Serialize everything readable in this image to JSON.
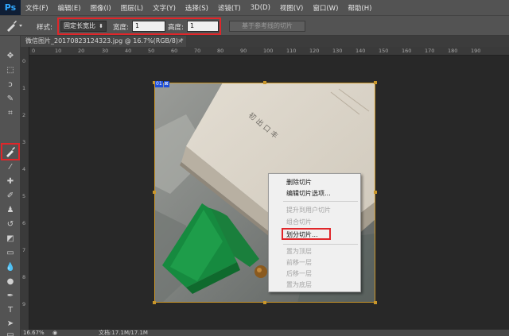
{
  "app": {
    "logo": "Ps"
  },
  "menu": [
    "文件(F)",
    "编辑(E)",
    "图像(I)",
    "图层(L)",
    "文字(Y)",
    "选择(S)",
    "滤镜(T)",
    "3D(D)",
    "视图(V)",
    "窗口(W)",
    "帮助(H)"
  ],
  "options": {
    "style_label": "样式:",
    "style_value": "固定长宽比",
    "width_label": "宽度:",
    "width_value": "1",
    "height_label": "高度:",
    "height_value": "1",
    "guides_button": "基于参考线的切片"
  },
  "document": {
    "tab_title": "微信图片_20170823124323.jpg @ 16.7%(RGB/8) *",
    "close": "×"
  },
  "ruler": {
    "top_ticks": [
      "0",
      "10",
      "20",
      "30",
      "40",
      "50",
      "60",
      "70",
      "80",
      "90",
      "100",
      "110",
      "120",
      "130",
      "140",
      "150",
      "160",
      "170",
      "180",
      "190"
    ],
    "left_ticks": [
      "0",
      "1",
      "2",
      "3",
      "4",
      "5",
      "6",
      "7",
      "8",
      "9"
    ]
  },
  "slice": {
    "badge_number": "01",
    "badge_icon": "⊠"
  },
  "image": {
    "book_text": "初 出 口 丰"
  },
  "context_menu": {
    "items": [
      {
        "label": "删除切片",
        "enabled": true
      },
      {
        "label": "编辑切片选项...",
        "enabled": true
      },
      {
        "label": "提升到用户切片",
        "enabled": false
      },
      {
        "label": "组合切片",
        "enabled": false
      },
      {
        "label": "划分切片...",
        "enabled": true
      },
      {
        "label": "置为顶层",
        "enabled": false
      },
      {
        "label": "前移一层",
        "enabled": false
      },
      {
        "label": "后移一层",
        "enabled": false
      },
      {
        "label": "置为底层",
        "enabled": false
      }
    ]
  },
  "status": {
    "zoom": "16.67%",
    "doc_info": "文档:17.1M/17.1M"
  },
  "colors": {
    "highlight": "#e0262a",
    "slice_border": "#c9962a",
    "badge": "#1f4fd8"
  }
}
